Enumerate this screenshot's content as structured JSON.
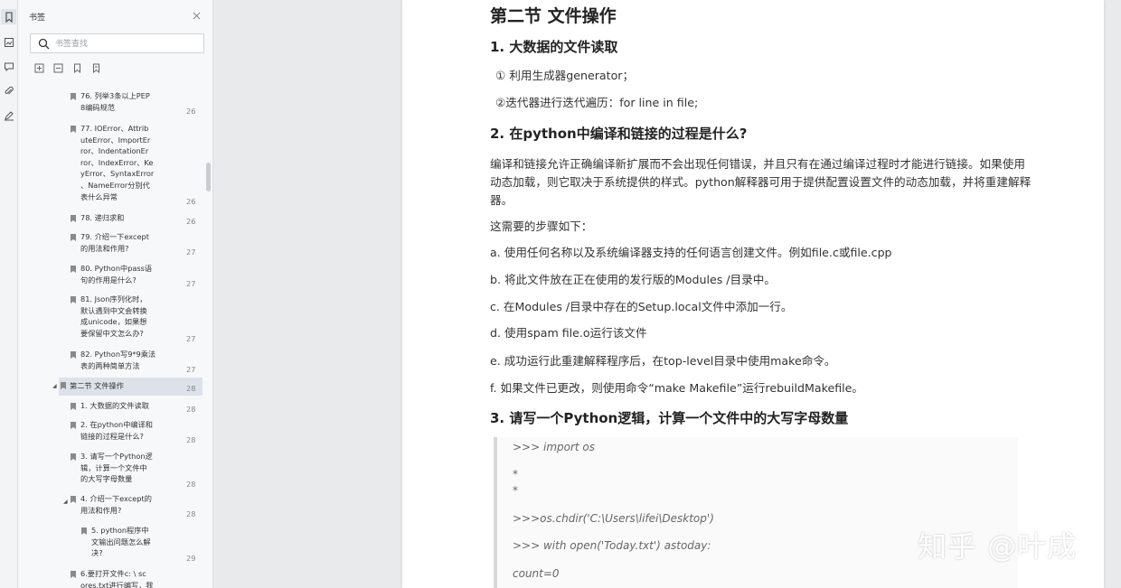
{
  "panel": {
    "title": "书签",
    "search_placeholder": "书签查找"
  },
  "bookmarks": [
    {
      "label": "76. 列举3条以上PEP\n8编码规范",
      "page": "26"
    },
    {
      "label": "77. IOError、Attrib\nuteError、ImportEr\nror、IndentationEr\nror、IndexError、Ke\nyError、SyntaxError\n、NameError分别代\n表什么异常",
      "page": "26"
    },
    {
      "label": "78. 递归求和",
      "page": "26"
    },
    {
      "label": "79. 介绍一下except\n的用法和作用?",
      "page": "27"
    },
    {
      "label": "80. Python中pass语\n句的作用是什么?",
      "page": "27"
    },
    {
      "label": "81. Json序列化时，\n默认遇到中文会转换\n成unicode，如果想\n要保留中文怎么办?",
      "page": "27"
    },
    {
      "label": "82. Python写9*9乘法\n表的两种简单方法",
      "page": "27"
    },
    {
      "label": "第二节 文件操作",
      "page": "28"
    },
    {
      "label": "1. 大数据的文件读取",
      "page": "28"
    },
    {
      "label": "2. 在python中编译和\n链接的过程是什么?",
      "page": "28"
    },
    {
      "label": "3. 请写一个Python逻\n辑，计算一个文件中\n的大写字母数量",
      "page": "28"
    },
    {
      "label": "4. 介绍一下except的\n用法和作用?",
      "page": "28"
    },
    {
      "label": "5. python程序中\n文输出问题怎么解\n决?",
      "page": "29"
    },
    {
      "label": "6.要打开文件c: \\ sc\nores.txt进行编写，我",
      "page": ""
    }
  ],
  "doc": {
    "section_title": "第二节 文件操作",
    "h1": "1. 大数据的文件读取",
    "p1": "① 利用生成器generator；",
    "p2": "②迭代器进行迭代遍历：for line in file;",
    "h2": "2. 在python中编译和链接的过程是什么?",
    "para1": "编译和链接允许正确编译新扩展而不会出现任何错误，并且只有在通过编译过程时才能进行链接。如果使用动态加载，则它取决于系统提供的样式。python解释器可用于提供配置设置文件的动态加载，并将重建解释器。",
    "p3": "这需要的步骤如下：",
    "step_a": "a. 使用任何名称以及系统编译器支持的任何语言创建文件。例如file.c或file.cpp",
    "step_b": "b. 将此文件放在正在使用的发行版的Modules /目录中。",
    "step_c": "c. 在Modules /目录中存在的Setup.local文件中添加一行。",
    "step_d": "d. 使用spam file.o运行该文件",
    "step_e": "e. 成功运行此重建解释程序后，在top-level目录中使用make命令。",
    "step_f": "f.  如果文件已更改，则使用命令“make Makefile”运行rebuildMakefile。",
    "h3": "3. 请写一个Python逻辑，计算一个文件中的大写字母数量",
    "code": [
      ">>> import os",
      "*",
      "*",
      ">>>os.chdir('C:\\Users\\lifei\\Desktop')",
      ">>> with open('Today.txt') astoday:",
      "count=0"
    ]
  },
  "watermark": "知乎 @叶成"
}
